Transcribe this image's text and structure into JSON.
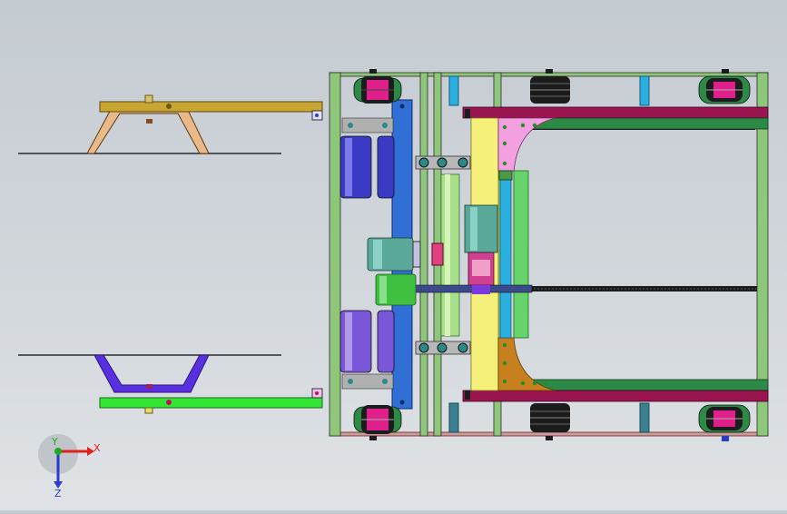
{
  "viewport": {
    "background_top": "#c4cbd1",
    "background_bottom": "#dfe3e6"
  },
  "triad": {
    "x_label": "X",
    "y_label": "Y",
    "z_label": "Z",
    "x_color": "#e0201c",
    "y_color": "#1faa1f",
    "z_color": "#2a3ccf"
  },
  "palette": {
    "frame_green": "#8fc77a",
    "outline": "#2a2a2a",
    "top_arm": "#c9a532",
    "top_bracket": "#e9b98a",
    "bottom_arm": "#34e634",
    "bottom_bracket": "#5a2fe0",
    "column_blue": "#2f6fd6",
    "yellow_plate": "#f5f07a",
    "pink_plate": "#f2a0e0",
    "orange_plate": "#c8801e",
    "maroon_rail": "#9a1550",
    "dark_green_rail": "#2c8a46",
    "light_green_bar": "#66d46a",
    "cyan_plate": "#2ab0e0",
    "motor_blue": "#3a3ac4",
    "motor_purple": "#7a56d8",
    "motor_teal": "#5aa89a",
    "wheel_pink": "#e0208a",
    "wheel_dark": "#1c1c1c"
  }
}
